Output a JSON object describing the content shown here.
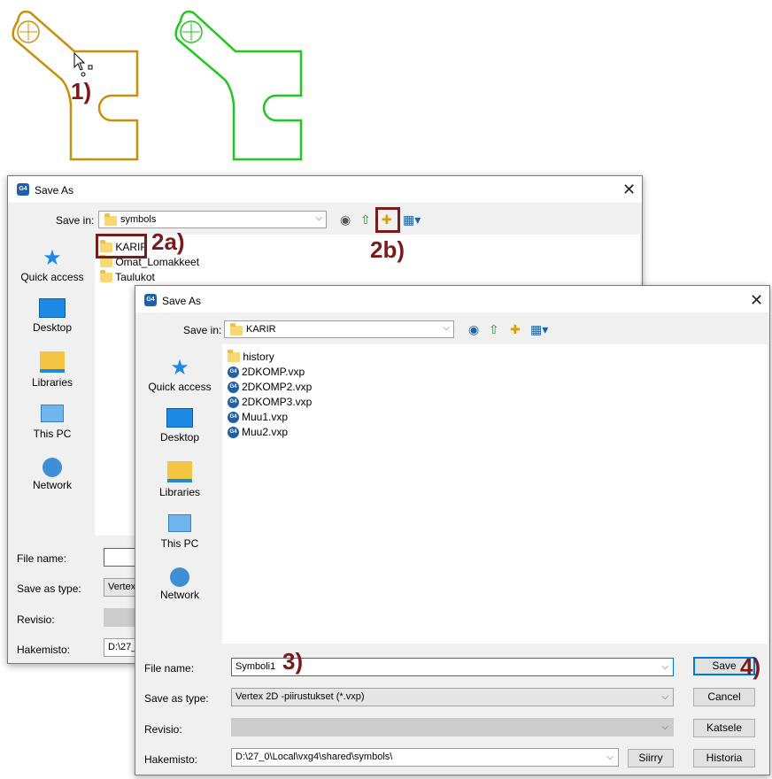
{
  "callouts": {
    "c1": "1)",
    "c2a": "2a)",
    "c2b": "2b)",
    "c3": "3)",
    "c4": "4)"
  },
  "colors": {
    "shape_selected": "#c8900a",
    "shape_green": "#1ec81e",
    "callout": "#7a1b1b",
    "accent": "#0078d7"
  },
  "dialog1": {
    "title": "Save As",
    "save_in_label": "Save in:",
    "save_in_value": "symbols",
    "places": [
      "Quick access",
      "Desktop",
      "Libraries",
      "This PC",
      "Network"
    ],
    "files": [
      "KARIR",
      "Omat_Lomakkeet",
      "Taulukot"
    ],
    "file_name_label": "File name:",
    "save_as_type_label": "Save as type:",
    "save_as_type_value": "Vertex",
    "revisio_label": "Revisio:",
    "hakemisto_label": "Hakemisto:",
    "hakemisto_value": "D:\\27_"
  },
  "dialog2": {
    "title": "Save As",
    "save_in_label": "Save in:",
    "save_in_value": "KARIR",
    "places": [
      "Quick access",
      "Desktop",
      "Libraries",
      "This PC",
      "Network"
    ],
    "folders": [
      "history"
    ],
    "files": [
      "2DKOMP.vxp",
      "2DKOMP2.vxp",
      "2DKOMP3.vxp",
      "Muu1.vxp",
      "Muu2.vxp"
    ],
    "file_name_label": "File name:",
    "file_name_value": "Symboli1",
    "save_as_type_label": "Save as type:",
    "save_as_type_value": "Vertex 2D -piirustukset (*.vxp)",
    "revisio_label": "Revisio:",
    "hakemisto_label": "Hakemisto:",
    "hakemisto_value": "D:\\27_0\\Local\\vxg4\\shared\\symbols\\",
    "buttons": {
      "save": "Save",
      "cancel": "Cancel",
      "katsele": "Katsele",
      "siirry": "Siirry",
      "historia": "Historia"
    }
  }
}
